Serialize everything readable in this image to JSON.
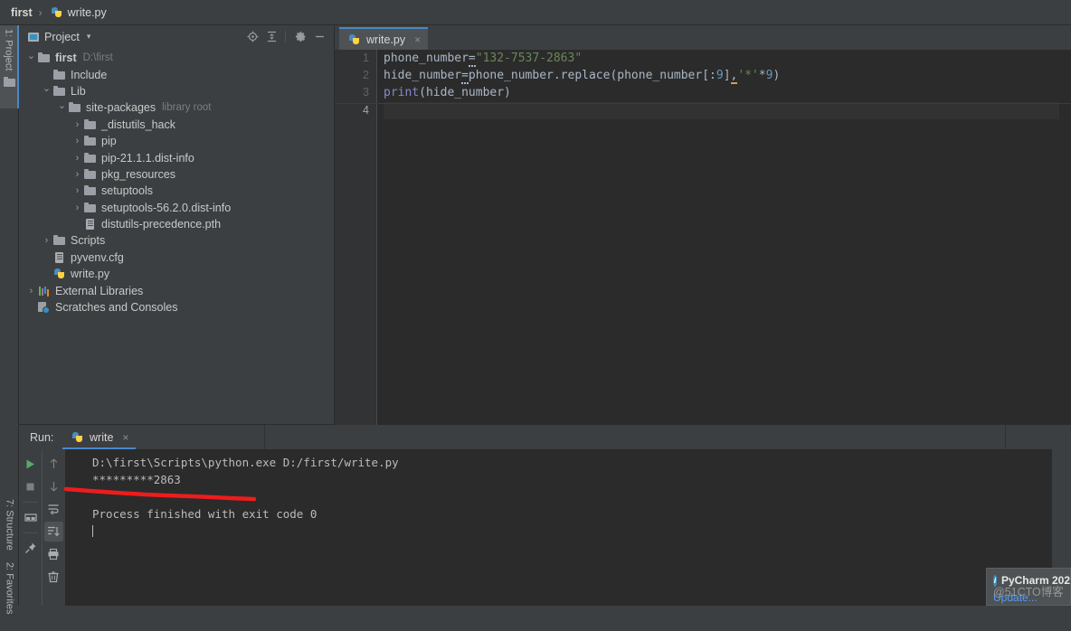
{
  "breadcrumb": {
    "project": "first",
    "separator": "›",
    "file": "write.py"
  },
  "left_strip": {
    "project_tab": "1: Project",
    "structure_tab": "7: Structure",
    "favorites_tab": "2: Favorites"
  },
  "project_panel": {
    "title": "Project",
    "caret": "▾",
    "icons": [
      {
        "name": "locate-icon",
        "glyph": "⊕"
      },
      {
        "name": "collapse-all-icon",
        "glyph": "⩝"
      },
      {
        "name": "gear-icon",
        "glyph": "⚙"
      },
      {
        "name": "hide-icon",
        "glyph": "—"
      }
    ],
    "tree": [
      {
        "indent": 0,
        "arrow": "⌄",
        "icon": "folder",
        "label": "first",
        "hint": "D:\\first",
        "bold": true
      },
      {
        "indent": 1,
        "arrow": "",
        "icon": "folder",
        "label": "Include",
        "hint": "",
        "bold": false
      },
      {
        "indent": 1,
        "arrow": "⌄",
        "icon": "folder",
        "label": "Lib",
        "hint": "",
        "bold": false
      },
      {
        "indent": 2,
        "arrow": "⌄",
        "icon": "folder",
        "label": "site-packages",
        "hint": "library root",
        "bold": false
      },
      {
        "indent": 3,
        "arrow": "›",
        "icon": "folder",
        "label": "_distutils_hack",
        "hint": "",
        "bold": false
      },
      {
        "indent": 3,
        "arrow": "›",
        "icon": "folder",
        "label": "pip",
        "hint": "",
        "bold": false
      },
      {
        "indent": 3,
        "arrow": "›",
        "icon": "folder",
        "label": "pip-21.1.1.dist-info",
        "hint": "",
        "bold": false
      },
      {
        "indent": 3,
        "arrow": "›",
        "icon": "folder",
        "label": "pkg_resources",
        "hint": "",
        "bold": false
      },
      {
        "indent": 3,
        "arrow": "›",
        "icon": "folder",
        "label": "setuptools",
        "hint": "",
        "bold": false
      },
      {
        "indent": 3,
        "arrow": "›",
        "icon": "folder",
        "label": "setuptools-56.2.0.dist-info",
        "hint": "",
        "bold": false
      },
      {
        "indent": 3,
        "arrow": "",
        "icon": "file",
        "label": "distutils-precedence.pth",
        "hint": "",
        "bold": false
      },
      {
        "indent": 1,
        "arrow": "›",
        "icon": "folder",
        "label": "Scripts",
        "hint": "",
        "bold": false
      },
      {
        "indent": 1,
        "arrow": "",
        "icon": "file",
        "label": "pyvenv.cfg",
        "hint": "",
        "bold": false
      },
      {
        "indent": 1,
        "arrow": "",
        "icon": "py",
        "label": "write.py",
        "hint": "",
        "bold": false
      },
      {
        "indent": 0,
        "arrow": "›",
        "icon": "lib",
        "label": "External Libraries",
        "hint": "",
        "bold": false
      },
      {
        "indent": 0,
        "arrow": "",
        "icon": "scratch",
        "label": "Scratches and Consoles",
        "hint": "",
        "bold": false
      }
    ]
  },
  "editor": {
    "tab_label": "write.py",
    "tab_close": "×",
    "line_numbers": [
      "1",
      "2",
      "3",
      "4"
    ],
    "current_line": 4,
    "code_lines": [
      {
        "n": 1,
        "tokens": [
          {
            "t": "phone_number",
            "c": "id"
          },
          {
            "t": "=",
            "c": "err"
          },
          {
            "t": "\"132-7537-2863\"",
            "c": "str"
          }
        ]
      },
      {
        "n": 2,
        "tokens": [
          {
            "t": "hide_number",
            "c": "id"
          },
          {
            "t": "=",
            "c": "err"
          },
          {
            "t": "phone_number.replace(phone_number[:",
            "c": "id"
          },
          {
            "t": "9",
            "c": "num"
          },
          {
            "t": "]",
            "c": "id"
          },
          {
            "t": ",",
            "c": "warn"
          },
          {
            "t": "'*'",
            "c": "str"
          },
          {
            "t": "*",
            "c": "id"
          },
          {
            "t": "9",
            "c": "num"
          },
          {
            "t": ")",
            "c": "id"
          }
        ]
      },
      {
        "n": 3,
        "tokens": [
          {
            "t": "print",
            "c": "fn"
          },
          {
            "t": "(hide_number)",
            "c": "id"
          }
        ]
      },
      {
        "n": 4,
        "tokens": []
      }
    ]
  },
  "run_panel": {
    "label": "Run:",
    "tab_name": "write",
    "tab_close": "×",
    "toolbar_left": [
      {
        "name": "run-icon",
        "glyph": "▶",
        "color": "#59a869",
        "selected": false
      },
      {
        "name": "stop-icon",
        "glyph": "■",
        "color": "#7d7f80",
        "selected": false
      },
      {
        "name": "separator",
        "glyph": "",
        "color": "",
        "selected": false
      },
      {
        "name": "restore-layout-icon",
        "glyph": "▤",
        "color": "#a8acad",
        "selected": false
      },
      {
        "name": "separator",
        "glyph": "",
        "color": "",
        "selected": false
      },
      {
        "name": "pin-tab-icon",
        "glyph": "✐",
        "color": "#a8acad",
        "selected": false
      }
    ],
    "toolbar_right": [
      {
        "name": "up-arrow-icon",
        "glyph": "↑",
        "color": "#7d7f80",
        "selected": false
      },
      {
        "name": "down-arrow-icon",
        "glyph": "↓",
        "color": "#7d7f80",
        "selected": false
      },
      {
        "name": "soft-wrap-icon",
        "glyph": "↵",
        "color": "#a8acad",
        "selected": false
      },
      {
        "name": "scroll-to-end-icon",
        "glyph": "⤓",
        "color": "#a8acad",
        "selected": true
      },
      {
        "name": "print-icon",
        "glyph": "⎙",
        "color": "#a8acad",
        "selected": false
      },
      {
        "name": "clear-all-icon",
        "glyph": "Ὕ1",
        "color": "#a8acad",
        "selected": false
      }
    ],
    "console_lines": [
      "D:\\first\\Scripts\\python.exe D:/first/write.py",
      "*********2863",
      "",
      "Process finished with exit code 0"
    ]
  },
  "notification": {
    "title": "PyCharm 202",
    "link": "Update...",
    "info_glyph": "i"
  },
  "watermark": "@51CTO博客",
  "colors": {
    "accent_blue": "#4a88c7",
    "editor_bg": "#2b2b2b",
    "panel_bg": "#3c3f41",
    "string_green": "#6a8759",
    "number_blue": "#6897bb",
    "builtin_violet": "#8888c6",
    "annotation_red": "#ee1c1c",
    "run_green": "#59a869",
    "link_blue": "#589df6"
  }
}
